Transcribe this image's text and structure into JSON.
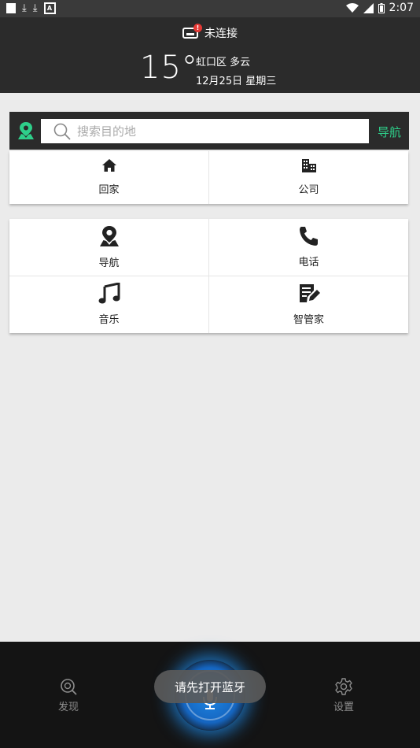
{
  "status_bar": {
    "time": "2:07",
    "icons": [
      "square-icon",
      "download-icon",
      "download-icon",
      "a-icon",
      "wifi-icon",
      "signal-icon",
      "battery-icon"
    ]
  },
  "header": {
    "connection_status": "未连接",
    "temperature": "15°",
    "location_weather": "虹口区 多云",
    "date": "12月25日 星期三"
  },
  "search": {
    "placeholder": "搜索目的地",
    "nav_button": "导航",
    "accent_color": "#2ecf8a"
  },
  "shortcuts": [
    {
      "label": "回家",
      "icon": "home-icon"
    },
    {
      "label": "公司",
      "icon": "building-icon"
    }
  ],
  "features": [
    {
      "label": "导航",
      "icon": "location-pin-icon"
    },
    {
      "label": "电话",
      "icon": "phone-icon"
    },
    {
      "label": "音乐",
      "icon": "music-note-icon"
    },
    {
      "label": "智管家",
      "icon": "notes-edit-icon"
    }
  ],
  "bottom_nav": {
    "discover": "发现",
    "settings": "设置"
  },
  "toast": "请先打开蓝牙"
}
